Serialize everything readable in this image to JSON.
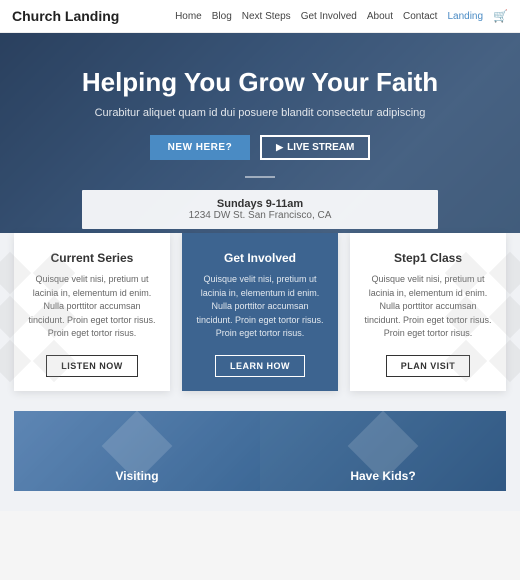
{
  "header": {
    "logo": "Church Landing",
    "nav": [
      {
        "label": "Home",
        "active": false
      },
      {
        "label": "Blog",
        "active": false
      },
      {
        "label": "Next Steps",
        "active": false
      },
      {
        "label": "Get Involved",
        "active": false
      },
      {
        "label": "About",
        "active": false
      },
      {
        "label": "Contact",
        "active": false
      },
      {
        "label": "Landing",
        "active": true
      }
    ],
    "cart_icon": "🛒"
  },
  "hero": {
    "title": "Helping You Grow Your  Faith",
    "subtitle": "Curabitur aliquet quam id dui posuere blandit consectetur adipiscing",
    "btn_new": "NEW HERE?",
    "btn_live": "LIVE STREAM",
    "info_title": "Sundays 9-11am",
    "info_address": "1234 DW St. San Francisco, CA"
  },
  "cards": [
    {
      "title": "Current Series",
      "text": "Quisque velit nisi, pretium ut lacinia in, elementum id enim. Nulla porttitor accumsan tincidunt. Proin eget tortor risus. Proin eget tortor risus.",
      "btn": "LISTEN NOW",
      "featured": false
    },
    {
      "title": "Get Involved",
      "text": "Quisque velit nisi, pretium ut lacinia in, elementum id enim. Nulla porttitor accumsan tincidunt. Proin eget tortor risus. Proin eget tortor risus.",
      "btn": "LEARN HOW",
      "featured": true
    },
    {
      "title": "Step1 Class",
      "text": "Quisque velit nisi, pretium ut lacinia in, elementum id enim. Nulla porttitor accumsan tincidunt. Proin eget tortor risus. Proin eget tortor risus.",
      "btn": "PLAN VISIT",
      "featured": false
    }
  ],
  "tiles": [
    {
      "label": "Visiting"
    },
    {
      "label": "Have Kids?"
    }
  ]
}
